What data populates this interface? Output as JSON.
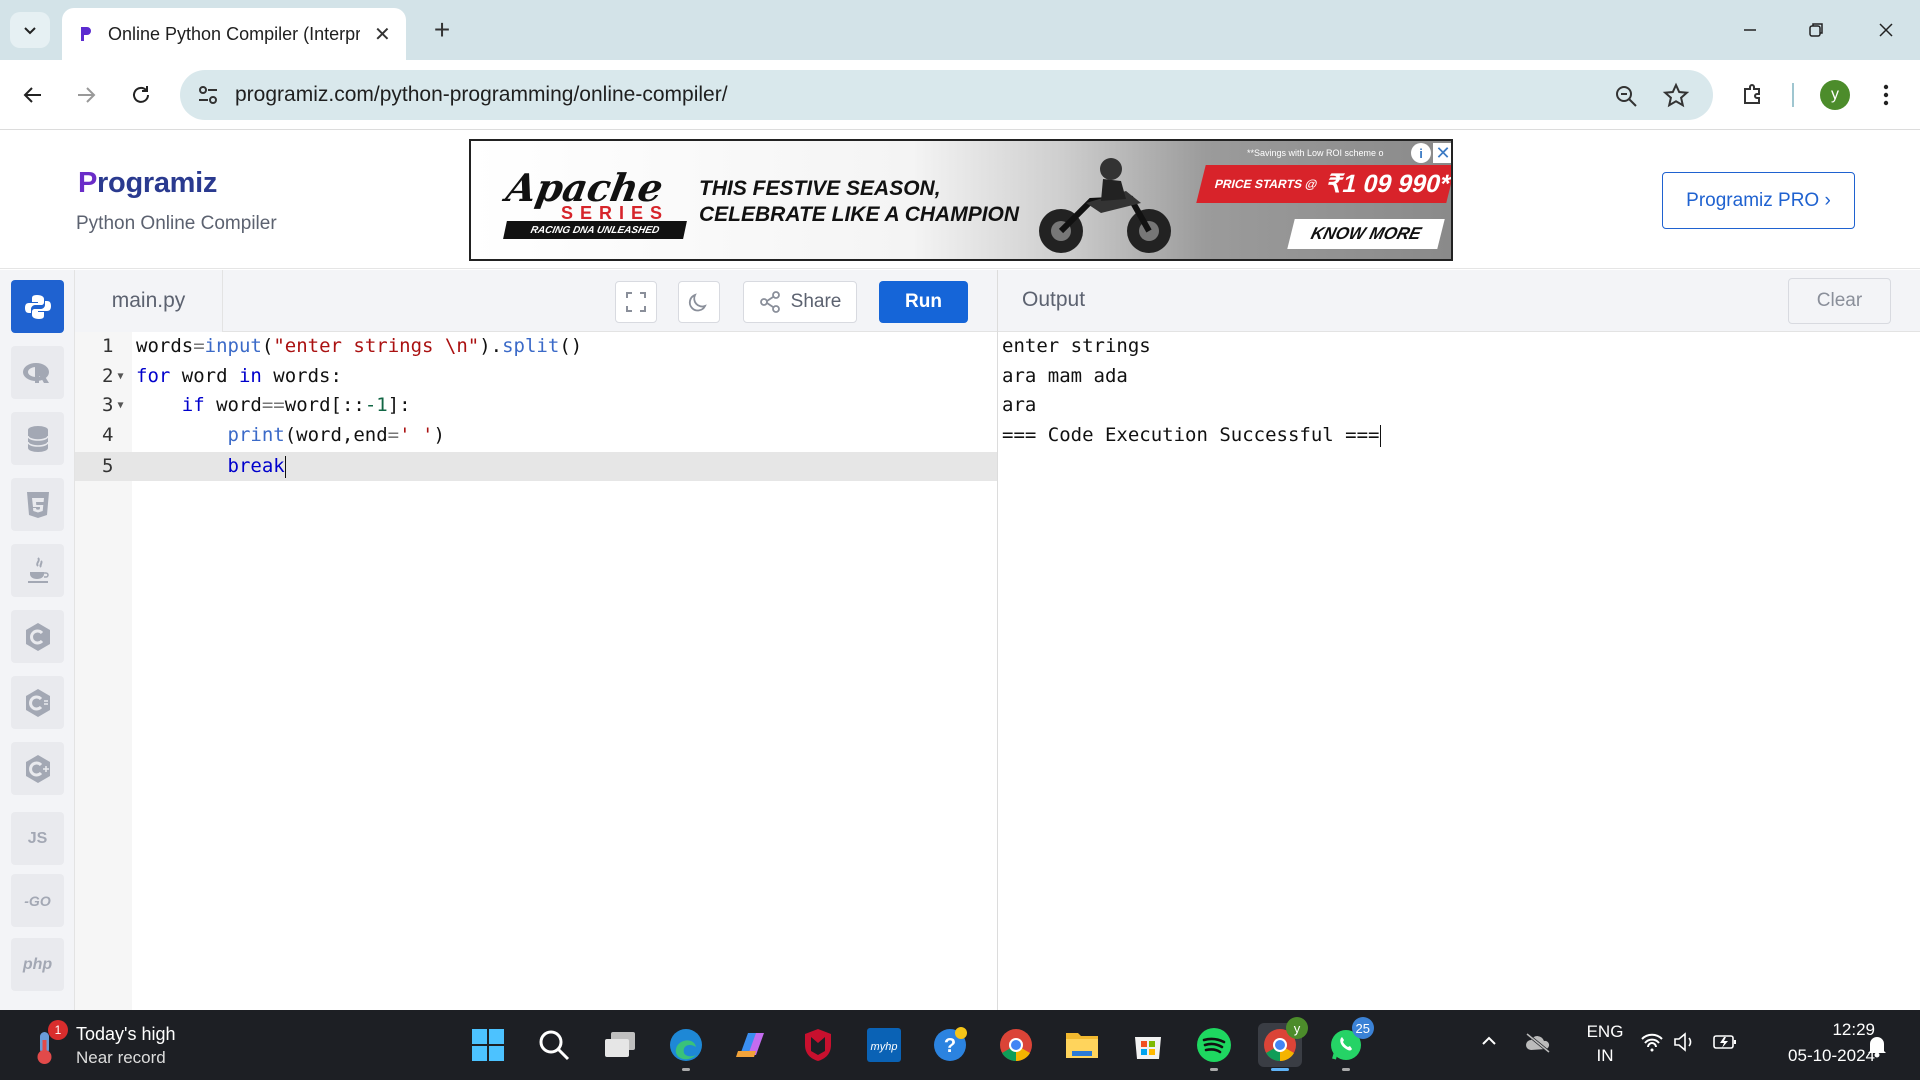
{
  "browser": {
    "tab_title": "Online Python Compiler (Interpreter)",
    "url": "programiz.com/python-programming/online-compiler/",
    "profile_initial": "y"
  },
  "site": {
    "logo_text": "rogramiz",
    "logo_initial": "P",
    "subtitle": "Python Online Compiler",
    "pro_button": "Programiz PRO ›"
  },
  "ad": {
    "brand": "Apache",
    "series": "SERIES",
    "tagline": "RACING DNA UNLEASHED",
    "headline_1": "THIS FESTIVE SEASON,",
    "headline_2": "CELEBRATE LIKE A CHAMPION",
    "fine_print": "**Savings with Low ROI scheme o",
    "price_label": "PRICE STARTS @",
    "price_value": "₹1 09 990*",
    "cta": "KNOW MORE",
    "info": "i",
    "close": "✕"
  },
  "languages": [
    "python-icon",
    "r-icon",
    "sql-icon",
    "html-icon",
    "java-icon",
    "c-icon",
    "csharp-icon",
    "cpp-icon",
    "js-icon",
    "go-icon",
    "php-icon"
  ],
  "lang_labels": {
    "js": "JS",
    "go": "-GO",
    "php": "php"
  },
  "editor": {
    "file_name": "main.py",
    "share_label": "Share",
    "run_label": "Run",
    "line_numbers": [
      "1",
      "2",
      "3",
      "4",
      "5"
    ],
    "code": [
      "words=input(\"enter strings \\n\").split()",
      "for word in words:",
      "    if word==word[::-1]:",
      "        print(word,end=' ')",
      "        break"
    ]
  },
  "output": {
    "title": "Output",
    "clear_label": "Clear",
    "lines": [
      "enter strings",
      "ara mam ada",
      "ara",
      "=== Code Execution Successful ==="
    ]
  },
  "taskbar": {
    "weather_title": "Today's high",
    "weather_sub": "Near record",
    "weather_badge": "1",
    "whatsapp_badge": "25",
    "chrome_profile_badge": "y",
    "lang_line1": "ENG",
    "lang_line2": "IN",
    "time": "12:29",
    "date": "05-10-2024"
  }
}
